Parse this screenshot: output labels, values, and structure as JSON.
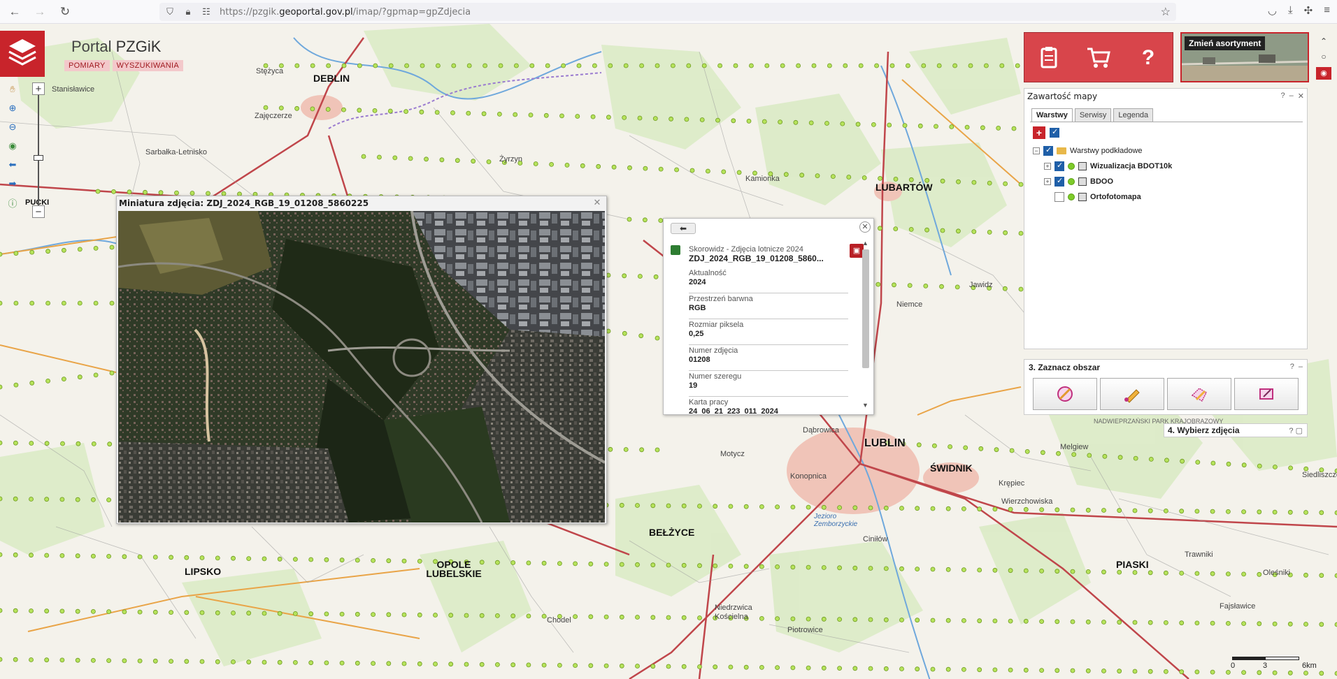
{
  "browser": {
    "url_prefix": "https://pzgik.",
    "url_domain": "geoportal.gov.pl",
    "url_suffix": "/imap/?gpmap=gpZdjecia"
  },
  "portal": {
    "title_light": "Portal ",
    "title_bold": "PZGiK",
    "links": [
      "POMIARY",
      "WYSZUKIWANIA"
    ]
  },
  "map": {
    "places": [
      {
        "name": "DEBLIN",
        "cls": "city"
      },
      {
        "name": "Stężyca",
        "cls": ""
      },
      {
        "name": "Stanisławice",
        "cls": ""
      },
      {
        "name": "Zajęczerze",
        "cls": ""
      },
      {
        "name": "Sarbałka-Letnisko",
        "cls": ""
      },
      {
        "name": "Żyrzyn",
        "cls": ""
      },
      {
        "name": "Kamionka",
        "cls": ""
      },
      {
        "name": "LUBARTÓW",
        "cls": "city"
      },
      {
        "name": "Jawidz",
        "cls": ""
      },
      {
        "name": "Niemce",
        "cls": ""
      },
      {
        "name": "LUBLIN",
        "cls": "big"
      },
      {
        "name": "ŚWIDNIK",
        "cls": "city"
      },
      {
        "name": "Dąbrowica",
        "cls": ""
      },
      {
        "name": "Motycz",
        "cls": ""
      },
      {
        "name": "Konopnica",
        "cls": ""
      },
      {
        "name": "Melgiew",
        "cls": ""
      },
      {
        "name": "Krępiec",
        "cls": ""
      },
      {
        "name": "Wierzchowiska",
        "cls": ""
      },
      {
        "name": "BEŁŻYCE",
        "cls": "city"
      },
      {
        "name": "LIPSKO",
        "cls": "city"
      },
      {
        "name": "OPOLE LUBELSKIE",
        "cls": "city"
      },
      {
        "name": "Chodel",
        "cls": ""
      },
      {
        "name": "Niedrzwica Kościelna",
        "cls": ""
      },
      {
        "name": "Piotrowice",
        "cls": ""
      },
      {
        "name": "Ciniłów",
        "cls": ""
      },
      {
        "name": "PIASKI",
        "cls": "city"
      },
      {
        "name": "Trawniki",
        "cls": ""
      },
      {
        "name": "Fajsławice",
        "cls": ""
      },
      {
        "name": "Oleśniki",
        "cls": ""
      },
      {
        "name": "Siedliszcze",
        "cls": ""
      },
      {
        "name": "PUCKI",
        "cls": "city"
      },
      {
        "name": "NADWIEPRZAŃSKI PARK KRAJOBRAZOWY",
        "cls": ""
      },
      {
        "name": "Jezioro Zemborzyckie",
        "cls": ""
      }
    ]
  },
  "thumbnail": {
    "title": "Miniatura zdjęcia: ZDJ_2024_RGB_19_01208_5860225"
  },
  "popup": {
    "source": "Skorowidz - Zdjęcia lotnicze 2024",
    "title": "ZDJ_2024_RGB_19_01208_5860...",
    "fields": [
      {
        "label": "Aktualność",
        "value": "2024"
      },
      {
        "label": "Przestrzeń barwna",
        "value": "RGB"
      },
      {
        "label": "Rozmiar piksela",
        "value": "0,25"
      },
      {
        "label": "Numer zdjęcia",
        "value": "01208"
      },
      {
        "label": "Numer szeregu",
        "value": "19"
      },
      {
        "label": "Karta pracy",
        "value": "24_06_21_223_011_2024"
      }
    ]
  },
  "assortment": {
    "label": "Zmień asortyment"
  },
  "mapContents": {
    "title": "Zawartość mapy",
    "tabs": [
      "Warstwy",
      "Serwisy",
      "Legenda"
    ],
    "layers": {
      "group": "Warstwy podkładowe",
      "items": [
        "Wizualizacja BDOT10k",
        "BDOO",
        "Ortofotomapa"
      ]
    }
  },
  "area": {
    "title": "3. Zaznacz obszar"
  },
  "step4": {
    "title": "4. Wybierz zdjęcia"
  },
  "scale": {
    "l0": "0",
    "l3": "3",
    "l6": "6km"
  },
  "colors": {
    "accent": "#c8242b",
    "map_road": "#c0464b"
  }
}
